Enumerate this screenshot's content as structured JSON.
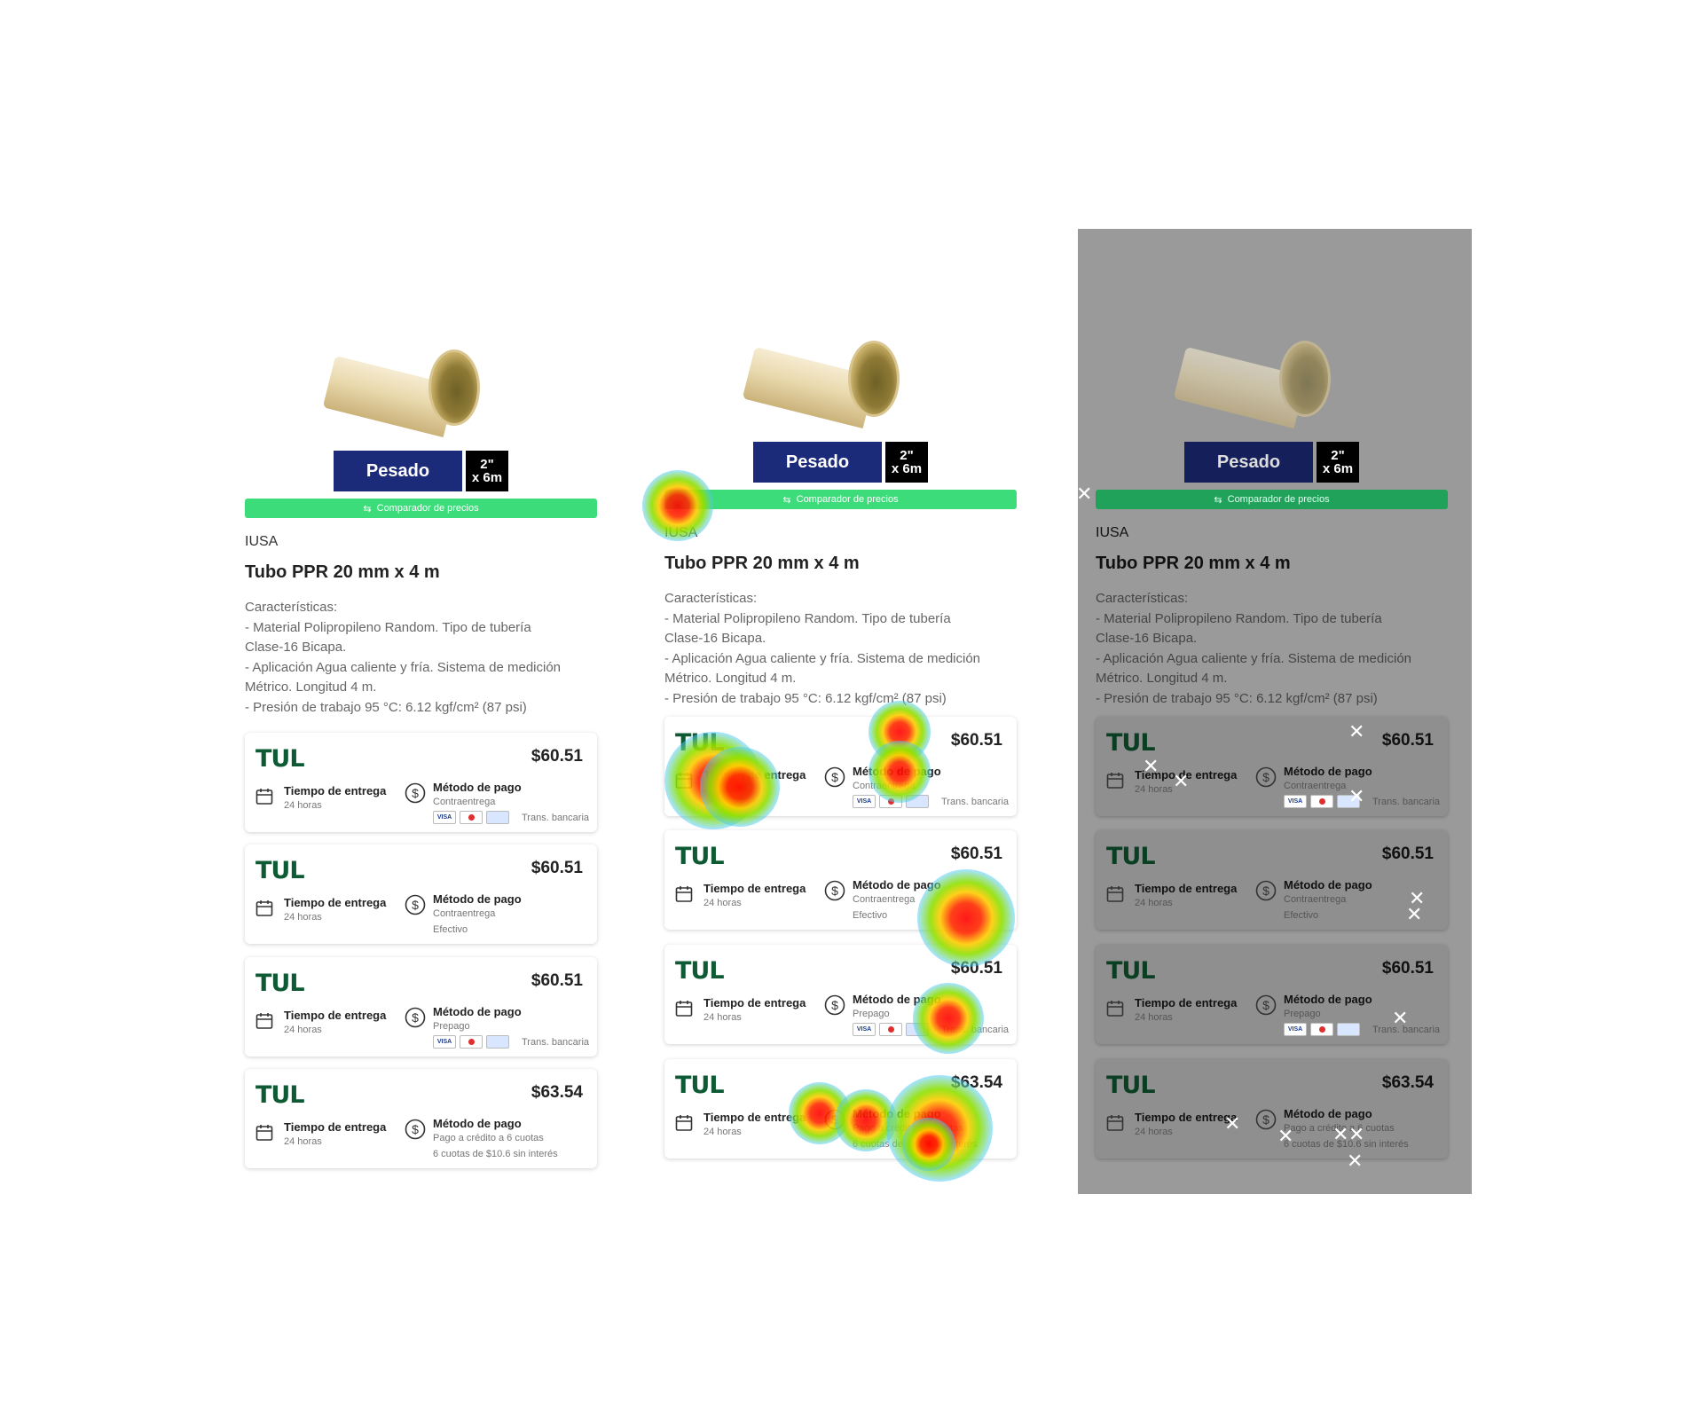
{
  "product": {
    "badge_label": "Pesado",
    "size_line1": "2\"",
    "size_line2": "x 6m",
    "comparador_label": "Comparador de precios",
    "brand": "IUSA",
    "title": "Tubo PPR 20 mm x 4 m",
    "features": [
      "Características:",
      "- Material Polipropileno Random. Tipo de tubería",
      "Clase-16 Bicapa.",
      "- Aplicación Agua caliente y fría. Sistema de medición",
      "Métrico. Longitud 4 m.",
      "- Presión de trabajo 95 °C: 6.12 kgf/cm² (87 psi)"
    ]
  },
  "offers": [
    {
      "logo": "TUL",
      "price": "$60.51",
      "delivery_label": "Tiempo de entrega",
      "delivery_value": "24 horas",
      "payment_label": "Método de pago",
      "payment_value": "Contraentrega",
      "payment_value2": "",
      "show_cards": true,
      "cards_note": "Trans. bancaria"
    },
    {
      "logo": "TUL",
      "price": "$60.51",
      "delivery_label": "Tiempo de entrega",
      "delivery_value": "24 horas",
      "payment_label": "Método de pago",
      "payment_value": "Contraentrega",
      "payment_value2": "Efectivo",
      "show_cards": false,
      "cards_note": ""
    },
    {
      "logo": "TUL",
      "price": "$60.51",
      "delivery_label": "Tiempo de entrega",
      "delivery_value": "24 horas",
      "payment_label": "Método de pago",
      "payment_value": "Prepago",
      "payment_value2": "",
      "show_cards": true,
      "cards_note": "Trans. bancaria"
    },
    {
      "logo": "TUL",
      "price": "$63.54",
      "delivery_label": "Tiempo de entrega",
      "delivery_value": "24 horas",
      "payment_label": "Método de pago",
      "payment_value": "Pago a crédito a 6 cuotas",
      "payment_value2": "6 cuotas de $10.6 sin interés",
      "show_cards": false,
      "cards_note": ""
    }
  ],
  "card_icons": [
    "visa-icon",
    "mastercard-icon",
    "amex-icon"
  ],
  "card_visa_text": "VISA",
  "colors": {
    "badge": "#1c2a7a",
    "comparador": "#3ddc7a",
    "tul_logo": "#0e5a34",
    "gray_overlay": "#9a9a9a",
    "heat_hot": "#ff0000"
  },
  "panels": [
    "original",
    "heatmap",
    "click-map"
  ]
}
